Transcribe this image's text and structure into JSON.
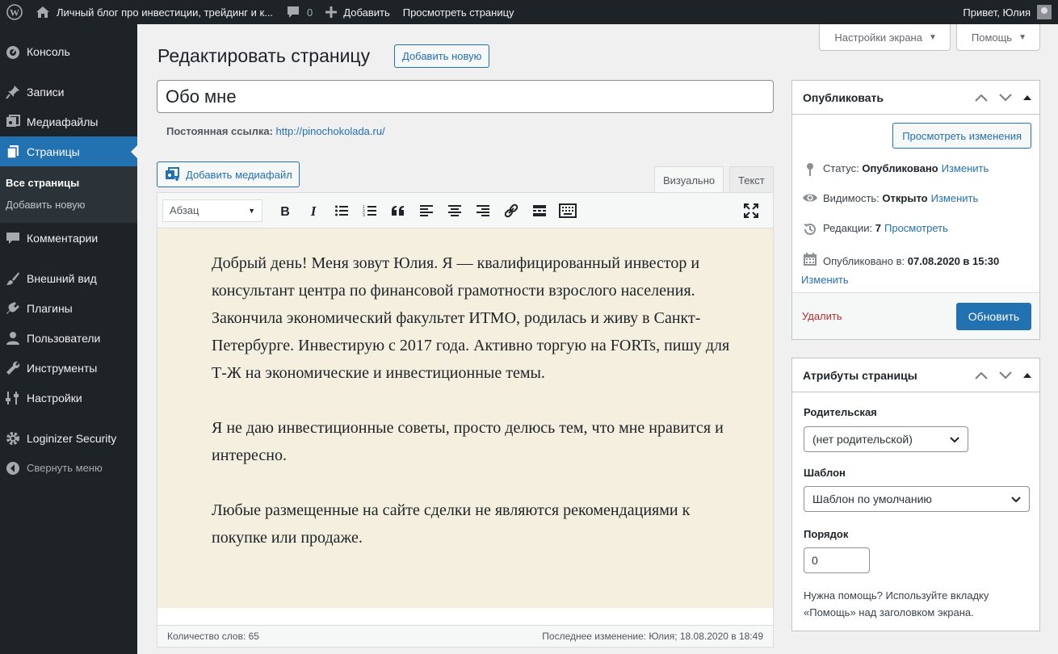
{
  "adminbar": {
    "site_name": "Личный блог про инвестиции, трейдинг и к...",
    "comments_count": "0",
    "new_label": "Добавить",
    "view_page": "Просмотреть страницу",
    "greeting": "Привет, Юлия"
  },
  "sidebar": {
    "items": [
      {
        "label": "Консоль",
        "icon": "dashboard-icon"
      },
      {
        "label": "Записи",
        "icon": "pin-icon"
      },
      {
        "label": "Медиафайлы",
        "icon": "media-icon"
      },
      {
        "label": "Страницы",
        "icon": "pages-icon"
      },
      {
        "label": "Комментарии",
        "icon": "comments-icon"
      },
      {
        "label": "Внешний вид",
        "icon": "brush-icon"
      },
      {
        "label": "Плагины",
        "icon": "plugin-icon"
      },
      {
        "label": "Пользователи",
        "icon": "users-icon"
      },
      {
        "label": "Инструменты",
        "icon": "wrench-icon"
      },
      {
        "label": "Настройки",
        "icon": "settings-icon"
      },
      {
        "label": "Loginizer Security",
        "icon": "gear-icon"
      }
    ],
    "submenu": [
      "Все страницы",
      "Добавить новую"
    ],
    "collapse": "Свернуть меню"
  },
  "screen_meta": {
    "screen_options": "Настройки экрана",
    "help": "Помощь"
  },
  "page": {
    "title": "Редактировать страницу",
    "add_new": "Добавить новую",
    "post_title": "Обо мне",
    "permalink_label": "Постоянная ссылка:",
    "permalink_url": "http://pinochokolada.ru/"
  },
  "editor": {
    "add_media": "Добавить медиафайл",
    "tab_visual": "Визуально",
    "tab_text": "Текст",
    "format": "Абзац",
    "paragraphs": [
      "Добрый день! Меня зовут Юлия. Я — квалифицированный инвестор и консультант центра по финансовой грамотности взрослого населения. Закончила экономический факультет ИТМО, родилась и живу в Санкт-Петербурге. Инвестирую с 2017 года. Активно торгую на FORTs, пишу для Т-Ж на экономические и инвестиционные темы.",
      "Я не даю инвестиционные советы, просто делюсь тем, что мне нравится и интересно.",
      "Любые размещенные на сайте сделки не являются рекомендациями к покупке или продаже."
    ],
    "word_count": "Количество слов: 65",
    "last_edit": "Последнее изменение: Юлия; 18.08.2020 в 18:49"
  },
  "publish": {
    "title": "Опубликовать",
    "preview": "Просмотреть изменения",
    "status_label": "Статус:",
    "status_value": "Опубликовано",
    "status_edit": "Изменить",
    "visibility_label": "Видимость:",
    "visibility_value": "Открыто",
    "visibility_edit": "Изменить",
    "revisions_label": "Редакции:",
    "revisions_value": "7",
    "revisions_view": "Просмотреть",
    "published_label": "Опубликовано в:",
    "published_value": "07.08.2020 в 15:30",
    "published_edit": "Изменить",
    "delete": "Удалить",
    "update": "Обновить"
  },
  "attributes": {
    "title": "Атрибуты страницы",
    "parent_label": "Родительская",
    "parent_value": "(нет родительской)",
    "template_label": "Шаблон",
    "template_value": "Шаблон по умолчанию",
    "order_label": "Порядок",
    "order_value": "0",
    "help": "Нужна помощь? Используйте вкладку «Помощь» над заголовком экрана."
  }
}
